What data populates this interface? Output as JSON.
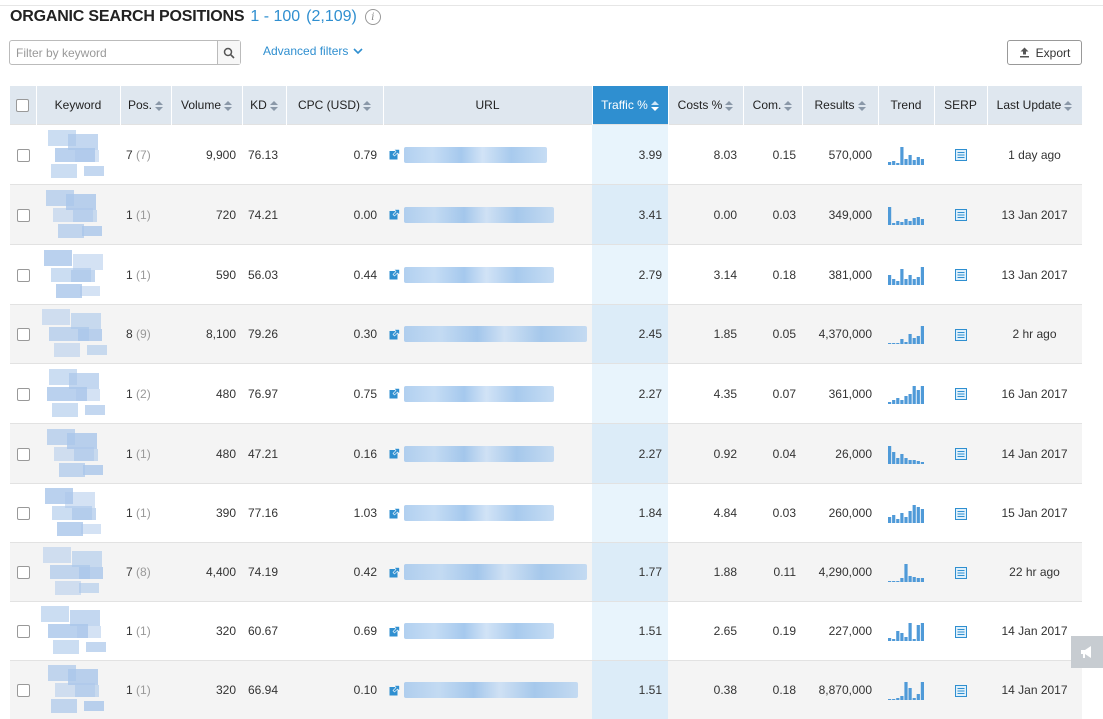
{
  "header": {
    "title": "ORGANIC SEARCH POSITIONS",
    "range": "1 - 100",
    "total": "(2,109)",
    "info_icon": "info-icon"
  },
  "toolbar": {
    "filter_placeholder": "Filter by keyword",
    "search_icon": "search-icon",
    "advanced_filters_label": "Advanced filters",
    "export_label": "Export"
  },
  "columns": [
    "Keyword",
    "Pos.",
    "Volume",
    "KD",
    "CPC (USD)",
    "URL",
    "Traffic %",
    "Costs %",
    "Com.",
    "Results",
    "Trend",
    "SERP",
    "Last Update"
  ],
  "sort_column": "Traffic %",
  "colors": {
    "accent": "#2f8fd0",
    "header_bg": "#dfe7ef",
    "highlight_col": "#e8f4fc"
  },
  "rows": [
    {
      "pos": "7",
      "prev": "(7)",
      "volume": "9,900",
      "kd": "76.13",
      "cpc": "0.79",
      "traffic": "3.99",
      "costs": "8.03",
      "com": "0.15",
      "results": "570,000",
      "updated": "1 day ago",
      "trend": [
        0.15,
        0.2,
        0.1,
        0.9,
        0.3,
        0.5,
        0.25,
        0.4,
        0.3
      ],
      "url_len": 0.78
    },
    {
      "pos": "1",
      "prev": "(1)",
      "volume": "720",
      "kd": "74.21",
      "cpc": "0.00",
      "traffic": "3.41",
      "costs": "0.00",
      "com": "0.03",
      "results": "349,000",
      "updated": "13 Jan 2017",
      "trend": [
        0.9,
        0.1,
        0.2,
        0.15,
        0.3,
        0.2,
        0.35,
        0.4,
        0.3
      ],
      "url_len": 0.82
    },
    {
      "pos": "1",
      "prev": "(1)",
      "volume": "590",
      "kd": "56.03",
      "cpc": "0.44",
      "traffic": "2.79",
      "costs": "3.14",
      "com": "0.18",
      "results": "381,000",
      "updated": "13 Jan 2017",
      "trend": [
        0.5,
        0.3,
        0.2,
        0.8,
        0.3,
        0.5,
        0.3,
        0.4,
        0.9
      ],
      "url_len": 0.82
    },
    {
      "pos": "8",
      "prev": "(9)",
      "volume": "8,100",
      "kd": "79.26",
      "cpc": "0.30",
      "traffic": "2.45",
      "costs": "1.85",
      "com": "0.05",
      "results": "4,370,000",
      "updated": "2 hr ago",
      "trend": [
        0.05,
        0.0,
        0.0,
        0.25,
        0.1,
        0.5,
        0.3,
        0.4,
        0.9
      ],
      "url_len": 1.0
    },
    {
      "pos": "1",
      "prev": "(2)",
      "volume": "480",
      "kd": "76.97",
      "cpc": "0.75",
      "traffic": "2.27",
      "costs": "4.35",
      "com": "0.07",
      "results": "361,000",
      "updated": "16 Jan 2017",
      "trend": [
        0.1,
        0.2,
        0.3,
        0.2,
        0.4,
        0.5,
        0.9,
        0.7,
        0.9
      ],
      "url_len": 0.82
    },
    {
      "pos": "1",
      "prev": "(1)",
      "volume": "480",
      "kd": "47.21",
      "cpc": "0.16",
      "traffic": "2.27",
      "costs": "0.92",
      "com": "0.04",
      "results": "26,000",
      "updated": "14 Jan 2017",
      "trend": [
        0.9,
        0.6,
        0.3,
        0.5,
        0.3,
        0.2,
        0.2,
        0.15,
        0.1
      ],
      "url_len": 0.82
    },
    {
      "pos": "1",
      "prev": "(1)",
      "volume": "390",
      "kd": "77.16",
      "cpc": "1.03",
      "traffic": "1.84",
      "costs": "4.84",
      "com": "0.03",
      "results": "260,000",
      "updated": "15 Jan 2017",
      "trend": [
        0.3,
        0.4,
        0.2,
        0.5,
        0.3,
        0.6,
        0.9,
        0.8,
        0.7
      ],
      "url_len": 0.82
    },
    {
      "pos": "7",
      "prev": "(8)",
      "volume": "4,400",
      "kd": "74.19",
      "cpc": "0.42",
      "traffic": "1.77",
      "costs": "1.88",
      "com": "0.11",
      "results": "4,290,000",
      "updated": "22 hr ago",
      "trend": [
        0.0,
        0.0,
        0.05,
        0.2,
        0.9,
        0.3,
        0.25,
        0.2,
        0.2
      ],
      "url_len": 1.0
    },
    {
      "pos": "1",
      "prev": "(1)",
      "volume": "320",
      "kd": "60.67",
      "cpc": "0.69",
      "traffic": "1.51",
      "costs": "2.65",
      "com": "0.19",
      "results": "227,000",
      "updated": "14 Jan 2017",
      "trend": [
        0.15,
        0.1,
        0.5,
        0.4,
        0.2,
        0.9,
        0.1,
        0.8,
        0.9
      ],
      "url_len": 0.82
    },
    {
      "pos": "1",
      "prev": "(1)",
      "volume": "320",
      "kd": "66.94",
      "cpc": "0.10",
      "traffic": "1.51",
      "costs": "0.38",
      "com": "0.18",
      "results": "8,870,000",
      "updated": "14 Jan 2017",
      "trend": [
        0.05,
        0.0,
        0.1,
        0.2,
        0.9,
        0.6,
        0.1,
        0.3,
        0.9
      ],
      "url_len": 0.95
    }
  ],
  "icons": {
    "row_link": "external-link-icon",
    "serp": "serp-icon",
    "corner": "megaphone-icon"
  }
}
